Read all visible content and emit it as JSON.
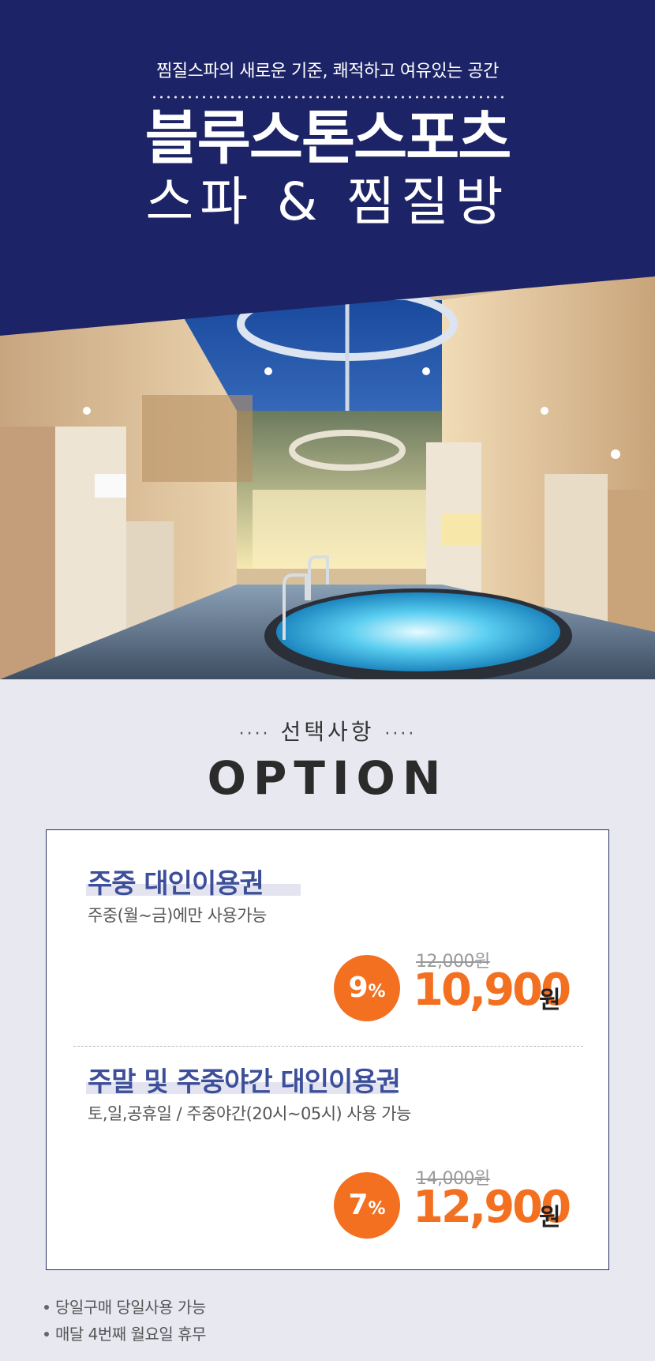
{
  "hero": {
    "tagline": "찜질스파의 새로운 기준, 쾌적하고 여유있는 공간",
    "brand": "블루스톤스포츠",
    "brand_sub": "스파 & 찜질방",
    "colors": {
      "navy": "#1c2366",
      "pool": "#39b7e6"
    }
  },
  "section": {
    "subtitle": "선택사항",
    "title": "OPTION"
  },
  "options": [
    {
      "title": "주중 대인이용권",
      "description": "주중(월~금)에만 사용가능",
      "discount": "9",
      "percent": "%",
      "original_price": "12,000원",
      "price": "10,900",
      "unit": "원"
    },
    {
      "title": "주말 및 주중야간 대인이용권",
      "description": "토,일,공휴일 / 주중야간(20시~05시) 사용 가능",
      "discount": "7",
      "percent": "%",
      "original_price": "14,000원",
      "price": "12,900",
      "unit": "원"
    }
  ],
  "notes": [
    "당일구매 당일사용 가능",
    "매달 4번째 월요일 휴무"
  ],
  "accent_color": "#f37021"
}
